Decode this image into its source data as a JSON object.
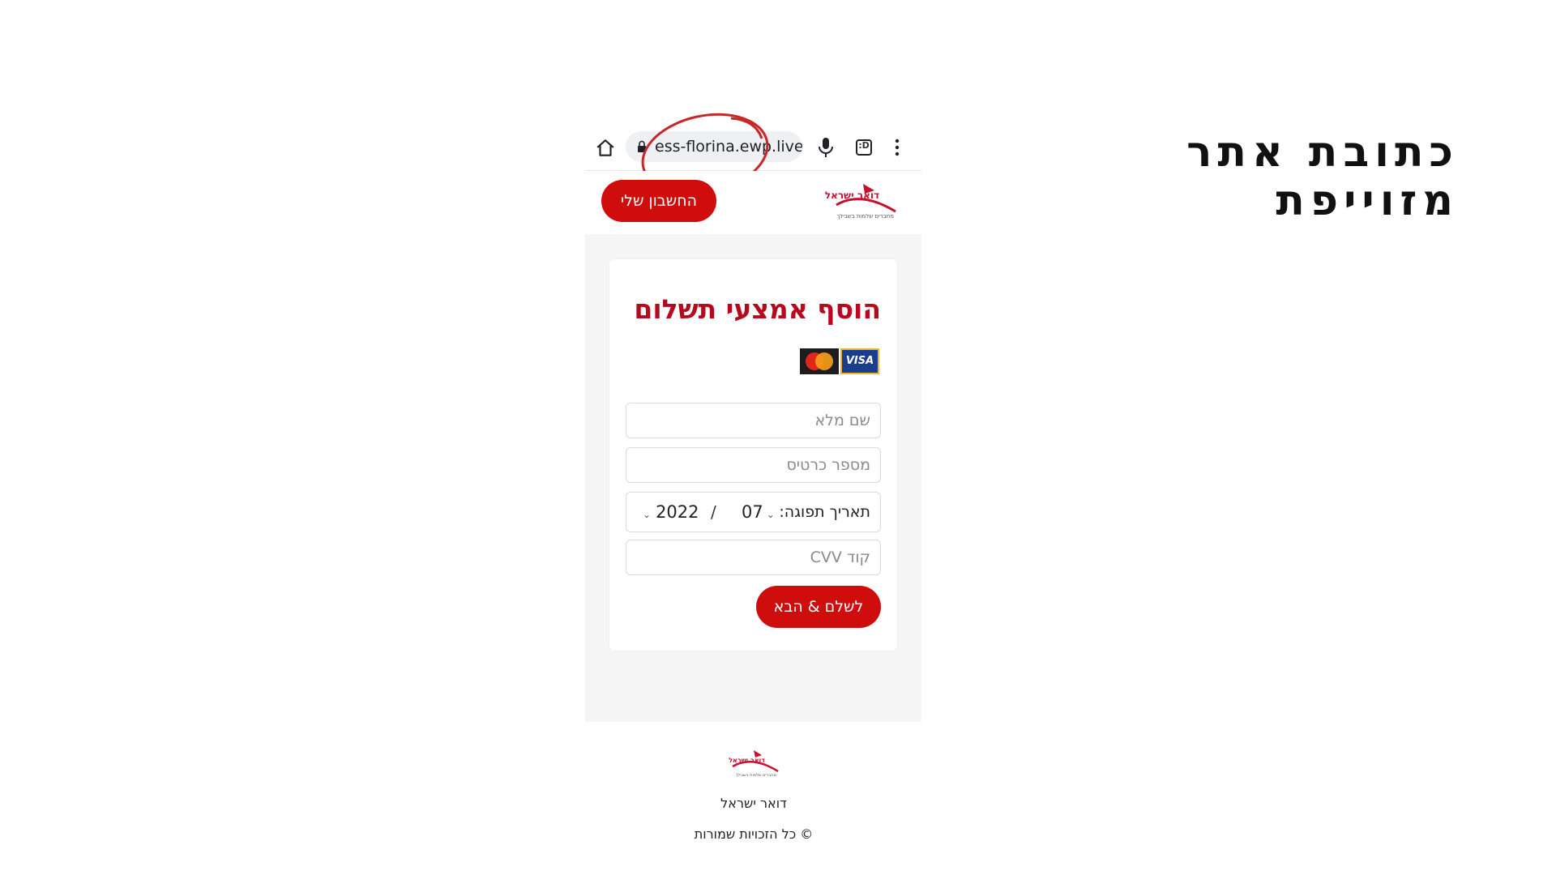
{
  "slide": {
    "title": "כתובת אתר מזוייפת"
  },
  "browser": {
    "url": "ess-florina.ewp.live",
    "tabs_count": ":D",
    "icons": [
      "home-icon",
      "lock-icon",
      "mic-icon",
      "tabs-icon",
      "menu-icon"
    ]
  },
  "header": {
    "account_label": "החשבון שלי",
    "logo_name": "israel-post-logo",
    "logo_text": "דואר ישראל",
    "logo_tagline": "מחברים שלמות בשבילך"
  },
  "form": {
    "title": "הוסף אמצעי תשלום",
    "card_logos": [
      "MasterCard",
      "VISA"
    ],
    "full_name_placeholder": "שם מלא",
    "card_number_placeholder": "מספר כרטיס",
    "expiry_label": "תאריך תפוגה:",
    "expiry_month": "07",
    "expiry_slash": "/",
    "expiry_year": "2022",
    "cvv_placeholder": "קוד CVV",
    "submit_label": "לשלם & הבא"
  },
  "footer": {
    "org_name": "דואר ישראל",
    "copyright": "© כל הזכויות שמורות"
  },
  "colors": {
    "brand_red": "#d00d0d",
    "title_red": "#b7091d",
    "highlight_circle": "#c62828"
  }
}
